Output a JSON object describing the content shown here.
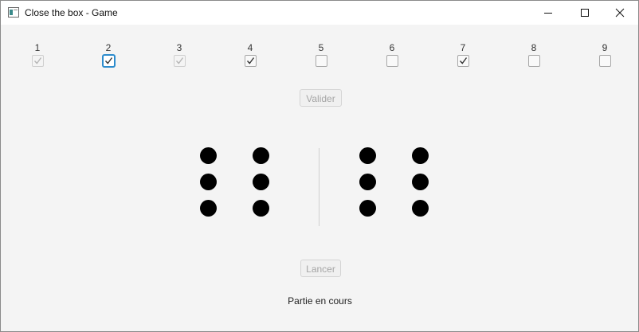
{
  "window": {
    "title": "Close the box - Game",
    "icon": "app-window-icon",
    "controls": [
      "minimize-icon",
      "maximize-icon",
      "close-icon"
    ]
  },
  "boxes": [
    {
      "label": "1",
      "checked": true,
      "disabled": true
    },
    {
      "label": "2",
      "checked": true,
      "disabled": false,
      "focused": true
    },
    {
      "label": "3",
      "checked": true,
      "disabled": true
    },
    {
      "label": "4",
      "checked": true,
      "disabled": false
    },
    {
      "label": "5",
      "checked": false,
      "disabled": false
    },
    {
      "label": "6",
      "checked": false,
      "disabled": false
    },
    {
      "label": "7",
      "checked": true,
      "disabled": false
    },
    {
      "label": "8",
      "checked": false,
      "disabled": false
    },
    {
      "label": "9",
      "checked": false,
      "disabled": false
    }
  ],
  "buttons": {
    "validate_label": "Valider",
    "roll_label": "Lancer"
  },
  "dice": [
    6,
    6
  ],
  "status": "Partie en cours",
  "colors": {
    "pip": "#000000",
    "focus": "#2d8ccd",
    "disabled_text": "#a5a5a5"
  }
}
